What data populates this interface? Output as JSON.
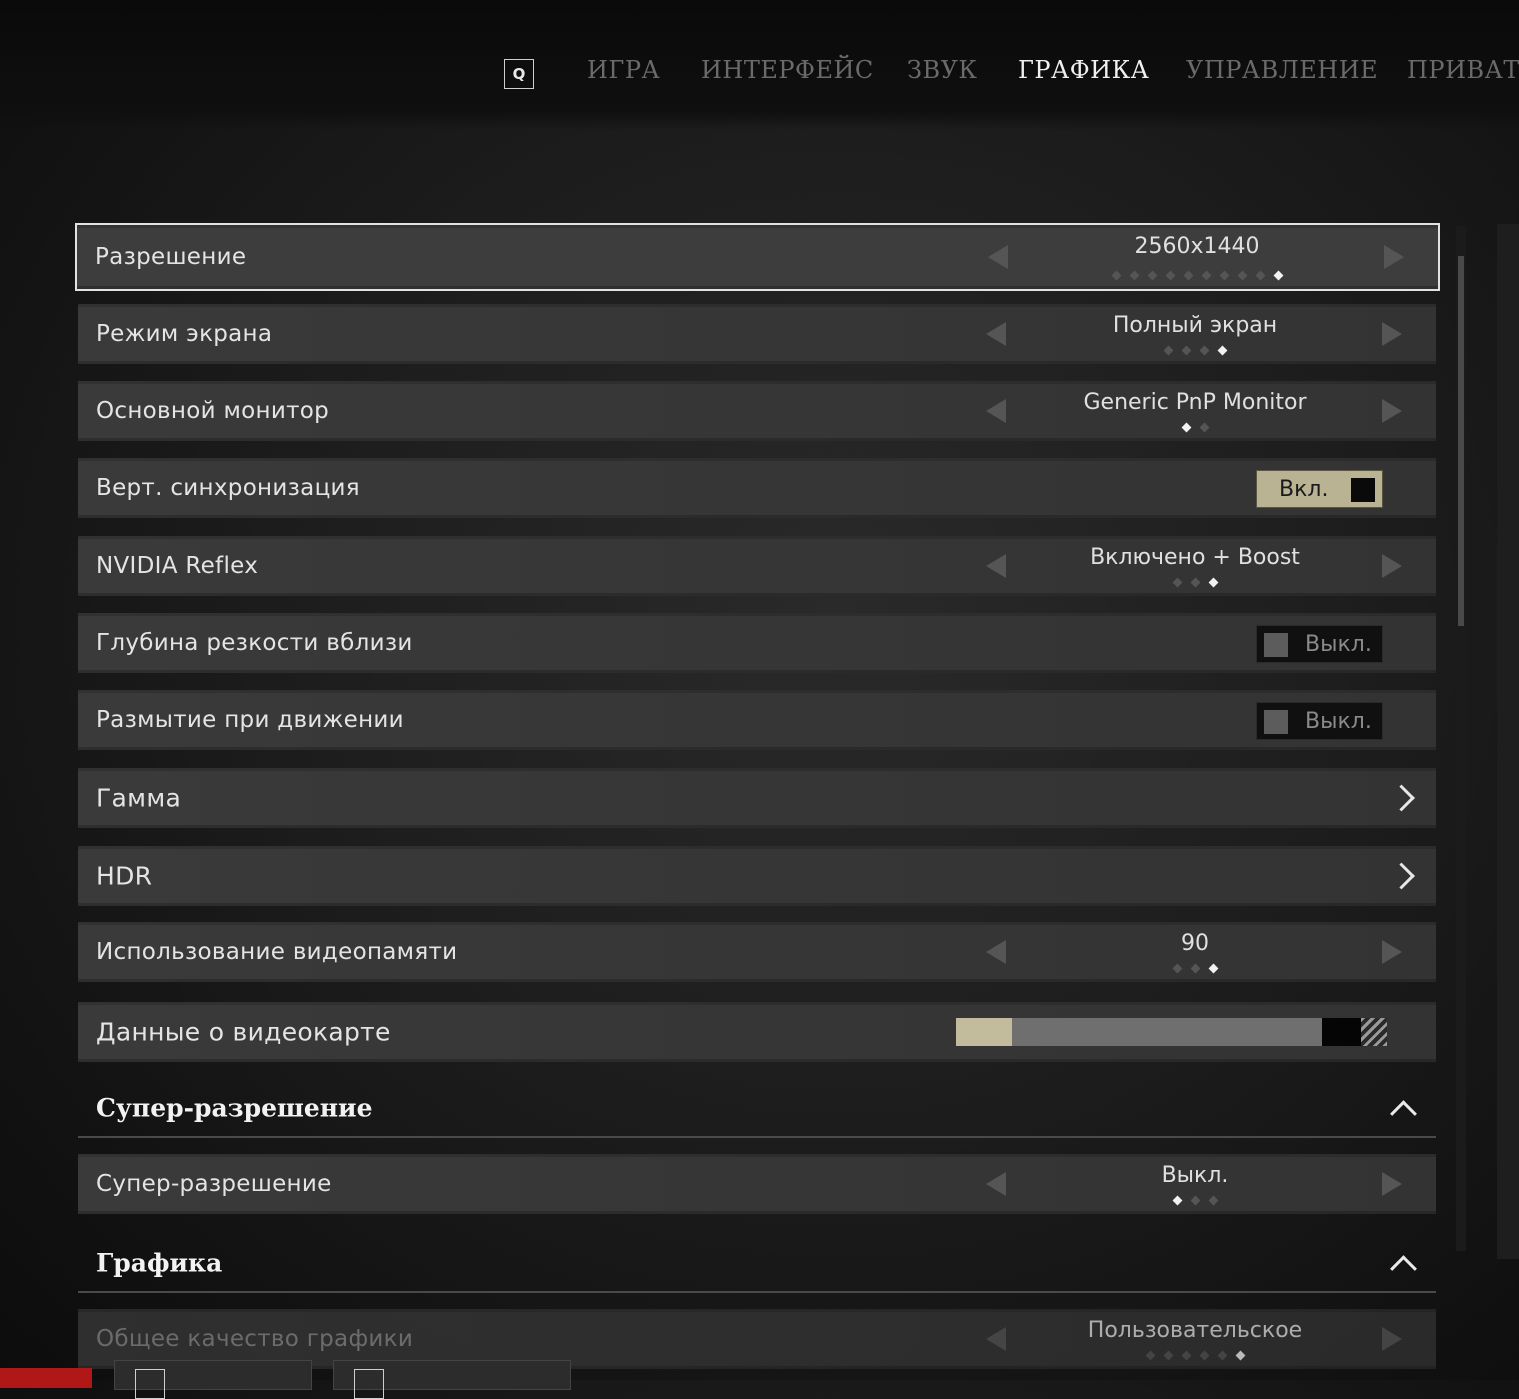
{
  "nav": {
    "q_key": "Q",
    "tabs": [
      {
        "label": "ИГРА"
      },
      {
        "label": "ИНТЕРФЕЙС"
      },
      {
        "label": "ЗВУК"
      },
      {
        "label": "ГРАФИКА",
        "active": true
      },
      {
        "label": "УПРАВЛЕНИЕ"
      },
      {
        "label": "ПРИВАТ"
      }
    ]
  },
  "settings": {
    "resolution": {
      "label": "Разрешение",
      "value": "2560x1440",
      "options_count": 10,
      "selected_index": 9
    },
    "screen_mode": {
      "label": "Режим экрана",
      "value": "Полный экран",
      "options_count": 4,
      "selected_index": 3
    },
    "monitor": {
      "label": "Основной монитор",
      "value": "Generic PnP Monitor",
      "options_count": 2,
      "selected_index": 0
    },
    "vsync": {
      "label": "Верт. синхронизация",
      "value": "Вкл."
    },
    "reflex": {
      "label": "NVIDIA Reflex",
      "value": "Включено + Boost",
      "options_count": 3,
      "selected_index": 2
    },
    "dof": {
      "label": "Глубина резкости вблизи",
      "value": "Выкл."
    },
    "motion_blur": {
      "label": "Размытие при движении",
      "value": "Выкл."
    },
    "gamma": {
      "label": "Гамма"
    },
    "hdr": {
      "label": "HDR"
    },
    "vram_usage": {
      "label": "Использование видеопамяти",
      "value": "90",
      "options_count": 3,
      "selected_index": 2
    },
    "gpu_info": {
      "label": "Данные о видеокарте",
      "vram_game_fraction": 0.13,
      "vram_other_fraction": 0.72,
      "vram_free_fraction": 0.09,
      "vram_reserved_fraction": 0.06
    }
  },
  "sections": {
    "super_resolution": {
      "title": "Супер-разрешение",
      "item": {
        "label": "Супер-разрешение",
        "value": "Выкл.",
        "options_count": 3,
        "selected_index": 0
      }
    },
    "graphics": {
      "title": "Графика",
      "item": {
        "label": "Общее качество графики",
        "value": "Пользовательское",
        "options_count": 6,
        "selected_index": 5
      }
    }
  },
  "colors": {
    "toggle_on": "#b9b293",
    "vram_used": "#c2bc9c",
    "red_button": "#b01818"
  }
}
